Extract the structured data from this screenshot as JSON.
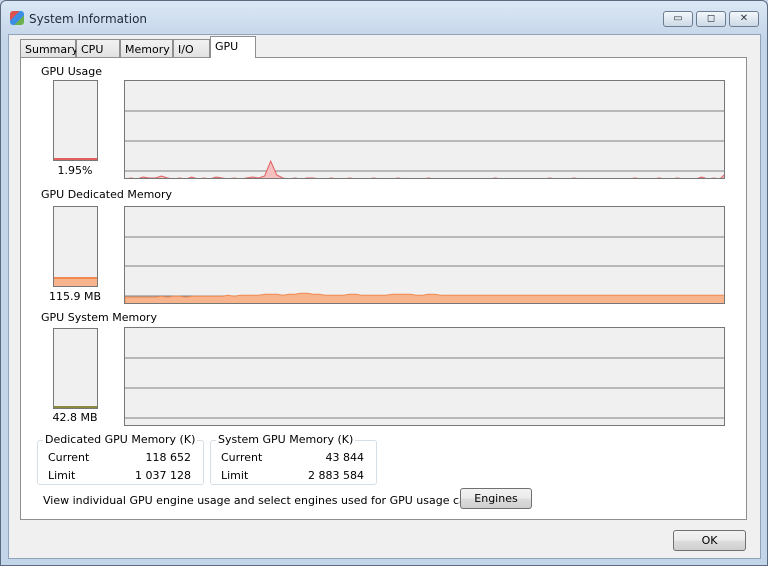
{
  "window": {
    "title": "System Information",
    "minimize": "▭",
    "maximize": "◻",
    "close": "✕"
  },
  "tabs": [
    {
      "label": "Summary"
    },
    {
      "label": "CPU"
    },
    {
      "label": "Memory"
    },
    {
      "label": "I/O"
    },
    {
      "label": "GPU",
      "active": true
    }
  ],
  "gpu_usage": {
    "label": "GPU Usage",
    "value": "1.95%",
    "level_percent": 1.95,
    "color": "#e06060",
    "history": [
      0,
      1,
      0,
      2,
      1,
      1,
      3,
      1,
      0,
      1,
      0,
      2,
      0,
      1,
      0,
      2,
      1,
      0,
      1,
      0,
      1,
      2,
      1,
      3,
      18,
      4,
      1,
      0,
      1,
      0,
      1,
      1,
      0,
      0,
      1,
      0,
      0,
      1,
      0,
      0,
      0,
      1,
      0,
      0,
      0,
      1,
      0,
      0,
      0,
      0,
      1,
      0,
      0,
      0,
      0,
      0,
      0,
      0,
      0,
      0,
      0,
      1,
      0,
      0,
      0,
      0,
      0,
      0,
      0,
      0,
      1,
      0,
      0,
      0,
      1,
      0,
      0,
      0,
      0,
      0,
      0,
      0,
      0,
      0,
      1,
      0,
      0,
      0,
      1,
      0,
      0,
      1,
      0,
      0,
      0,
      2,
      0,
      1,
      0,
      6
    ]
  },
  "gpu_dedicated": {
    "label": "GPU Dedicated Memory",
    "value": "115.9 MB",
    "level_percent": 11.4,
    "color": "#f08a50",
    "history": [
      7,
      7,
      7,
      7,
      7,
      7,
      8,
      7,
      8,
      8,
      7,
      8,
      8,
      8,
      8,
      8,
      8,
      9,
      8,
      9,
      9,
      9,
      9,
      10,
      10,
      10,
      9,
      10,
      10,
      11,
      11,
      10,
      10,
      9,
      9,
      9,
      9,
      10,
      10,
      9,
      9,
      9,
      9,
      9,
      10,
      10,
      10,
      10,
      9,
      9,
      10,
      10,
      9,
      9,
      9,
      9,
      9,
      9,
      9,
      9,
      9,
      9,
      9,
      9,
      9,
      9,
      9,
      9,
      9,
      9,
      9,
      9,
      9,
      9,
      9,
      9,
      9,
      9,
      9,
      9,
      9,
      9,
      9,
      9,
      9,
      9,
      9,
      9,
      9,
      9,
      9,
      9,
      9,
      9,
      9,
      9,
      9,
      9,
      9,
      9
    ]
  },
  "gpu_system": {
    "label": "GPU System Memory",
    "value": "42.8 MB",
    "level_percent": 1.5,
    "color": "#8a8a40"
  },
  "dedicated_box": {
    "title": "Dedicated GPU Memory (K)",
    "current_label": "Current",
    "current": "118 652",
    "limit_label": "Limit",
    "limit": "1 037 128"
  },
  "system_box": {
    "title": "System GPU Memory (K)",
    "current_label": "Current",
    "current": "43 844",
    "limit_label": "Limit",
    "limit": "2 883 584"
  },
  "engines": {
    "text": "View individual GPU engine usage and select engines used for GPU usage calculations:",
    "button": "Engines"
  },
  "ok_button": "OK"
}
